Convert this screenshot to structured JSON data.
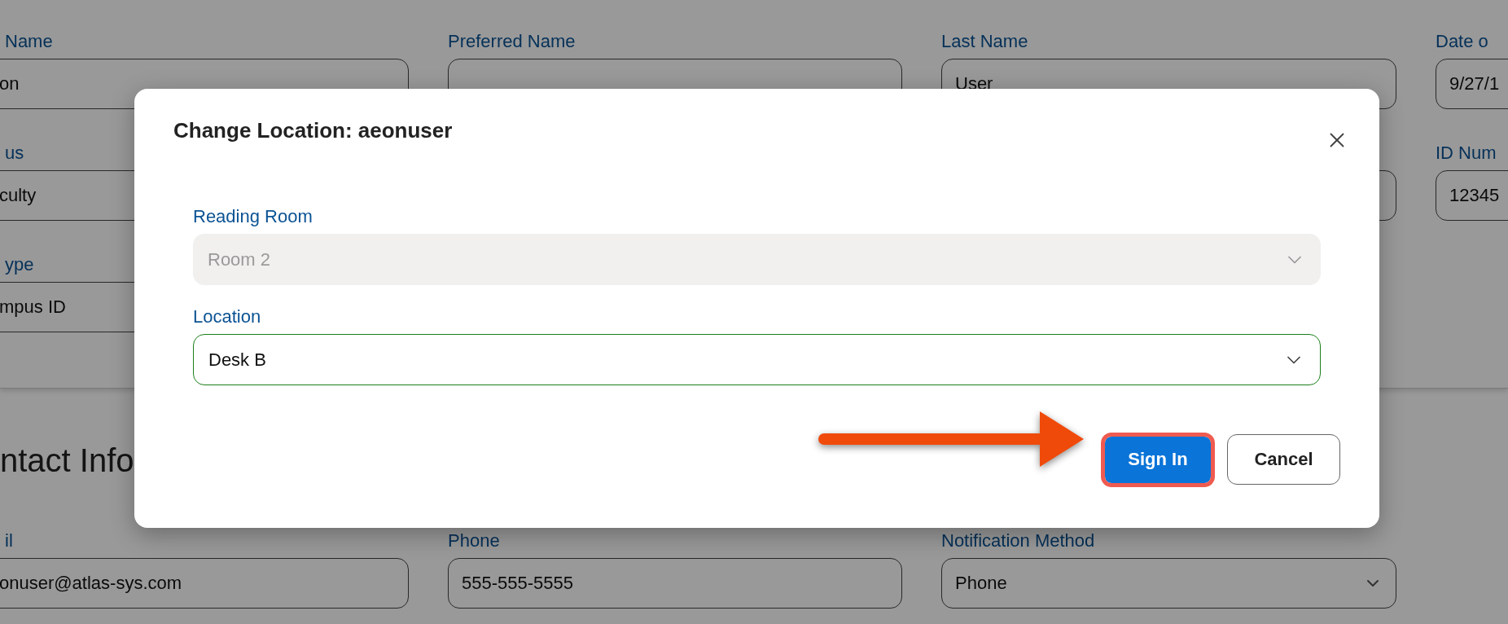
{
  "form": {
    "rows": [
      [
        {
          "label": "Name",
          "value": "on",
          "kind": "text"
        },
        {
          "label": "Preferred Name",
          "kind": "text"
        },
        {
          "label": "Last Name",
          "value": "User",
          "kind": "text"
        },
        {
          "label": "Date o",
          "value": "9/27/1",
          "kind": "text"
        }
      ],
      [
        {
          "label": "us",
          "value": "culty",
          "kind": "text"
        },
        null,
        {
          "kind": "text"
        },
        {
          "label": "ID Num",
          "value": "12345",
          "kind": "text"
        }
      ],
      [
        {
          "label": "ype",
          "value": "mpus ID",
          "kind": "text"
        },
        null,
        null,
        null
      ]
    ]
  },
  "contact": {
    "heading": "ntact Info",
    "fields": [
      {
        "label": "il",
        "value": "onuser@atlas-sys.com",
        "kind": "text"
      },
      {
        "label": "Phone",
        "value": "555-555-5555",
        "kind": "text"
      },
      {
        "label": "Notification Method",
        "value": "Phone",
        "kind": "select"
      }
    ]
  },
  "dialog": {
    "title": "Change Location: aeonuser",
    "fields": [
      {
        "label": "Reading Room",
        "value": "Room 2",
        "disabled": true,
        "focused": false
      },
      {
        "label": "Location",
        "value": "Desk B",
        "disabled": false,
        "focused": true
      }
    ],
    "buttons": [
      {
        "label": "Sign In",
        "kind": "primary",
        "highlighted": true
      },
      {
        "label": "Cancel",
        "kind": "secondary",
        "highlighted": false
      }
    ],
    "pointer_arrow": true
  }
}
